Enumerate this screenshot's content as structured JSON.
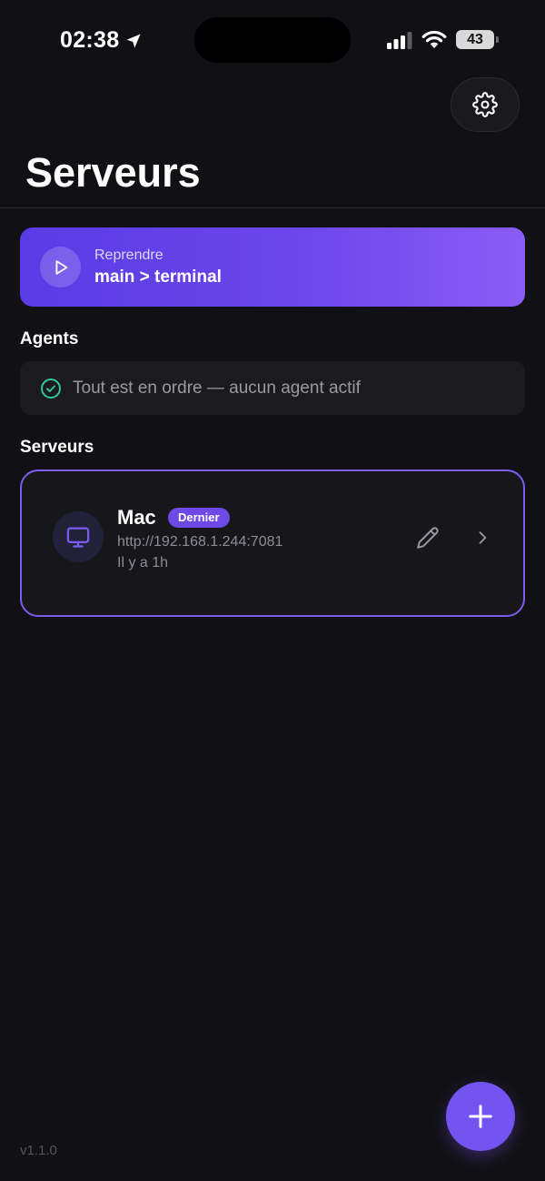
{
  "status_bar": {
    "time": "02:38",
    "battery": "43",
    "location_icon": "location-arrow-icon",
    "signal_icon": "cellular-signal-icon",
    "wifi_icon": "wifi-icon"
  },
  "header": {
    "title": "Serveurs",
    "settings_icon": "gear-icon"
  },
  "resume": {
    "kicker": "Reprendre",
    "title": "main > terminal",
    "icon": "play-icon"
  },
  "agents": {
    "heading": "Agents",
    "status_text": "Tout est en ordre — aucun agent actif",
    "status_icon": "check-circle-icon"
  },
  "servers": {
    "heading": "Serveurs",
    "items": [
      {
        "name": "Mac",
        "badge": "Dernier",
        "url": "http://192.168.1.244:7081",
        "last_seen": "Il y a 1h",
        "icon": "monitor-icon"
      }
    ]
  },
  "footer": {
    "version": "v1.1.0",
    "add_icon": "plus-icon"
  },
  "colors": {
    "background": "#111014",
    "accent": "#7354f0",
    "accent_gradient_start": "#5a3be6",
    "accent_gradient_end": "#8b5cf6",
    "success": "#34c79a",
    "muted_text": "#8e8d95"
  }
}
